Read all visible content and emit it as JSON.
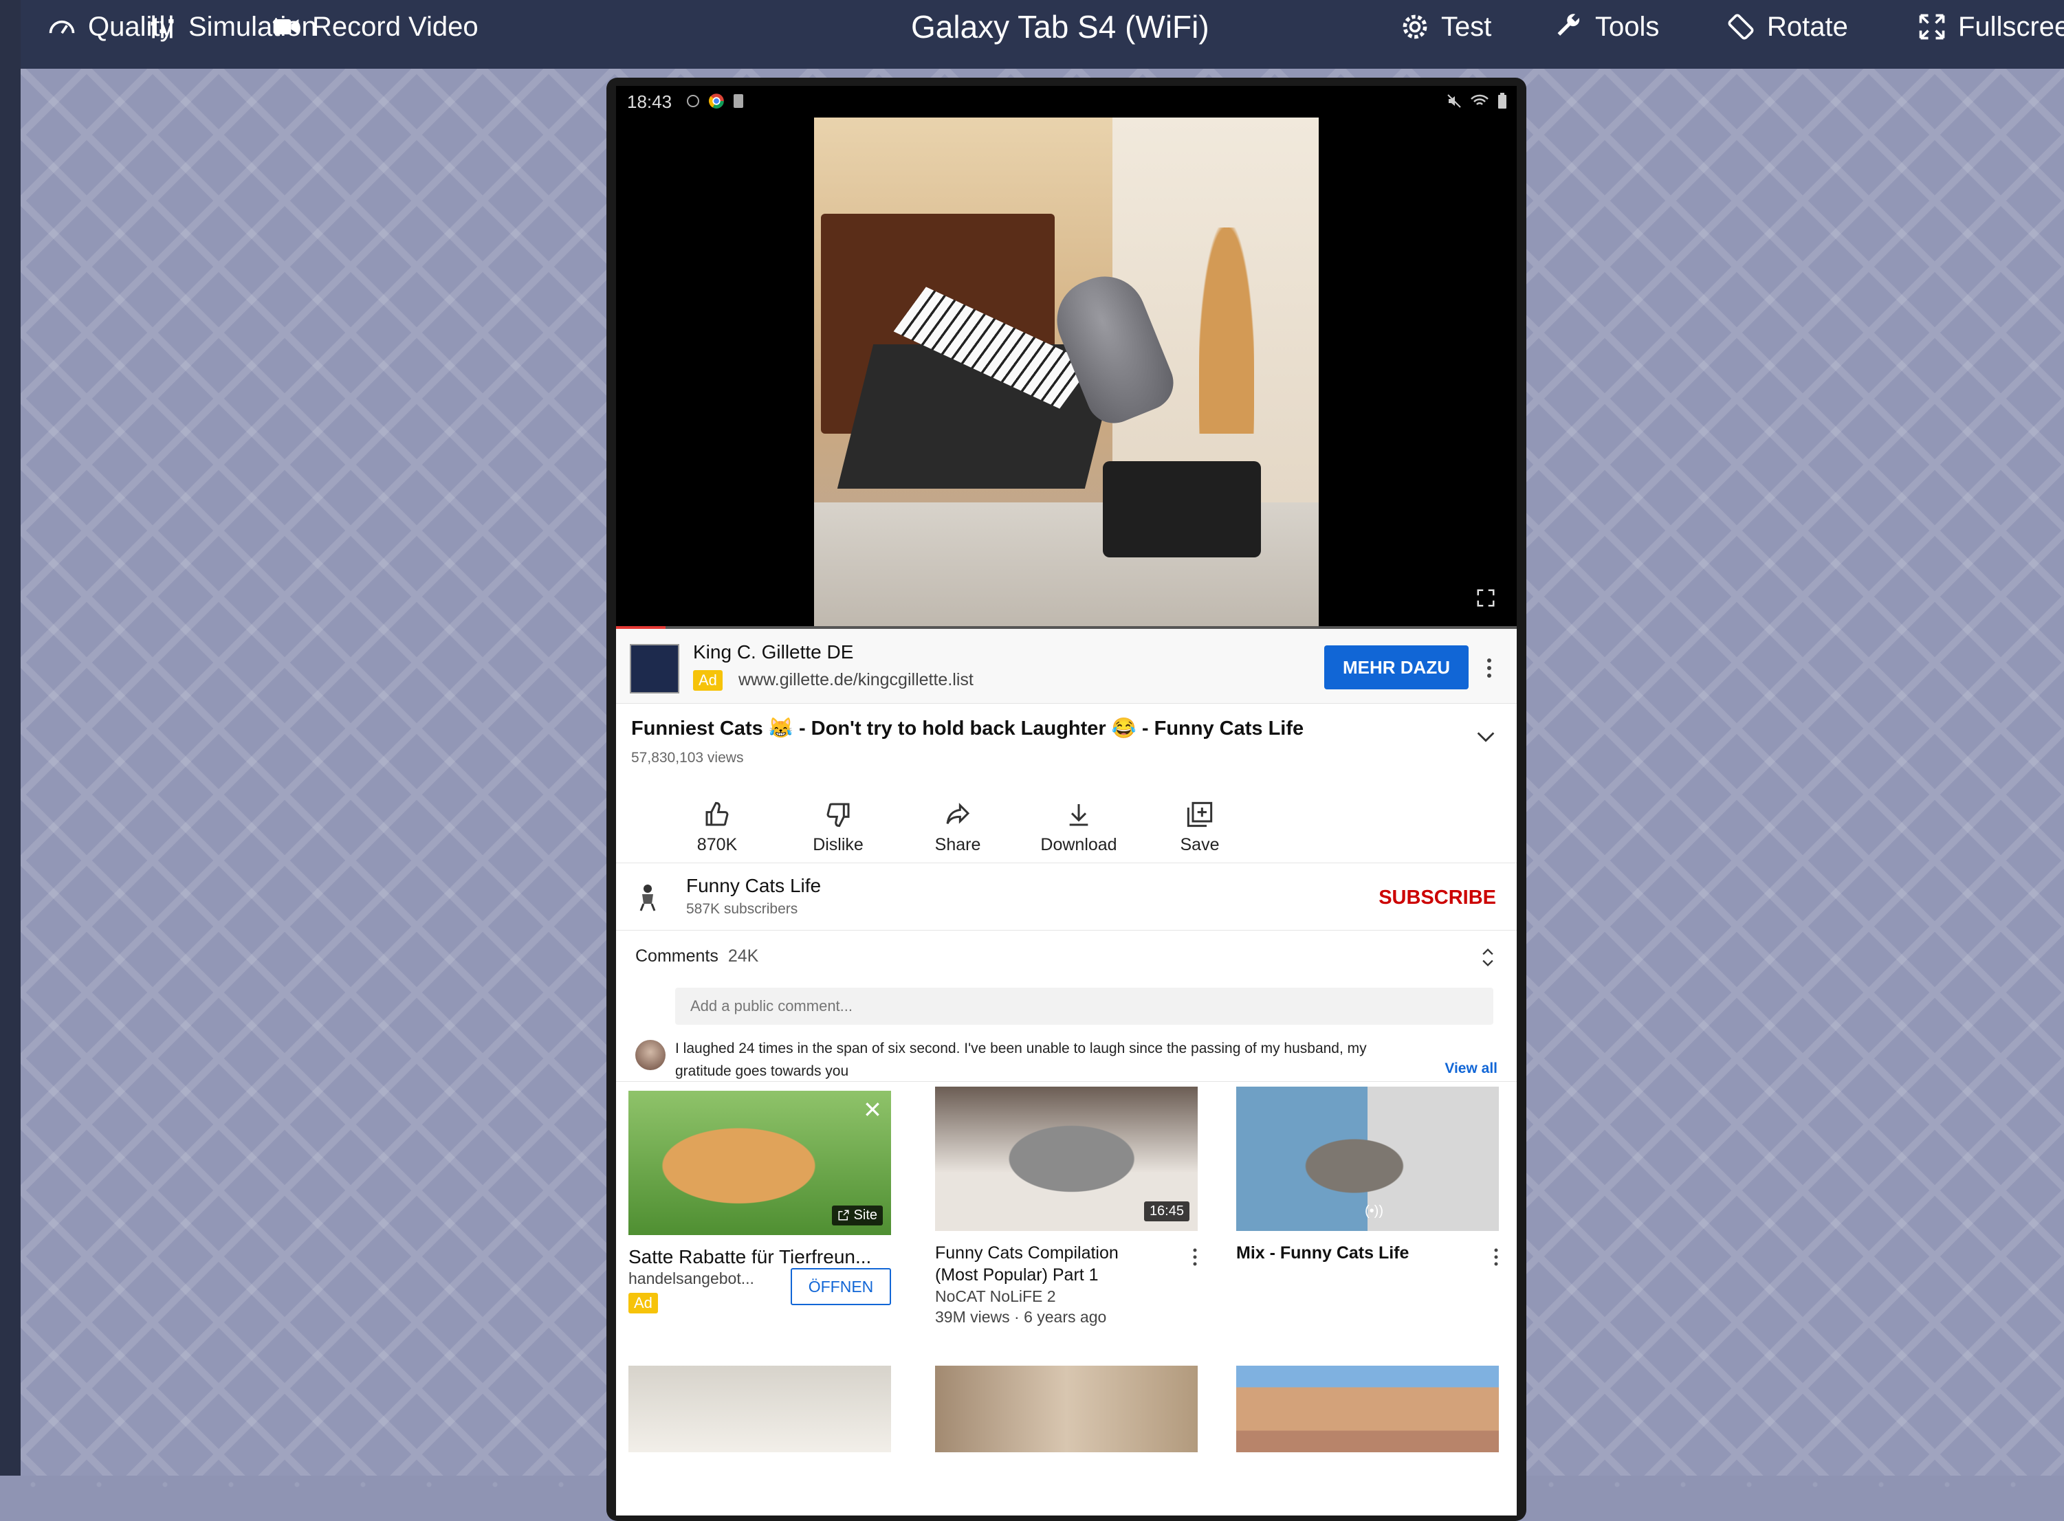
{
  "toolbar": {
    "quality": "Quality",
    "simulation": "Simulation",
    "record_video": "Record Video",
    "device_title": "Galaxy Tab S4 (WiFi)",
    "test": "Test",
    "tools": "Tools",
    "rotate": "Rotate",
    "fullscreen": "Fullscree"
  },
  "status": {
    "time": "18:43"
  },
  "video": {
    "progress_fraction": 0.055
  },
  "ad": {
    "advertiser": "King C. Gillette DE",
    "badge": "Ad",
    "url": "www.gillette.de/kingcgillette.list",
    "cta": "MEHR DAZU"
  },
  "title": {
    "text": "Funniest Cats 😹 - Don't try to hold back Laughter 😂 - Funny Cats Life",
    "views": "57,830,103 views"
  },
  "actions": {
    "like": "870K",
    "dislike": "Dislike",
    "share": "Share",
    "download": "Download",
    "save": "Save"
  },
  "channel": {
    "name": "Funny Cats Life",
    "subscribers": "587K subscribers",
    "subscribe": "SUBSCRIBE"
  },
  "comments": {
    "label": "Comments",
    "count": "24K",
    "placeholder": "Add a public comment...",
    "top_comment": "I laughed 24 times in the span of six second. I've been unable to laugh since the passing of my husband, my gratitude goes towards you",
    "view_all": "View all"
  },
  "cards": [
    {
      "title": "Satte Rabatte für Tierfreun...",
      "sub": "handelsangebot...",
      "badge": "Ad",
      "tag": "Site",
      "cta": "ÖFFNEN"
    },
    {
      "title_l1": "Funny Cats Compilation",
      "title_l2": "(Most Popular) Part 1",
      "channel": "NoCAT NoLiFE 2",
      "meta": "39M views · 6 years ago",
      "duration": "16:45"
    },
    {
      "title": "Mix - Funny Cats Life",
      "tag": "(•))"
    }
  ],
  "colors": {
    "toolbar_bg": "#2c3550",
    "cta_blue": "#1166d6",
    "subscribe_red": "#cc0000",
    "ad_yellow": "#f6c30a"
  }
}
